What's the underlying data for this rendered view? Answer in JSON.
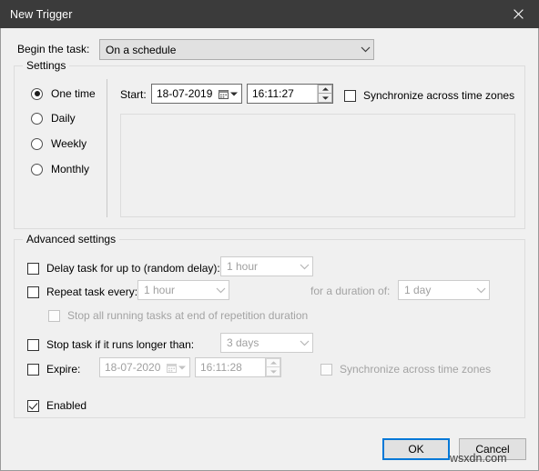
{
  "window": {
    "title": "New Trigger",
    "close_icon": "close-icon"
  },
  "begin": {
    "label": "Begin the task:",
    "value": "On a schedule",
    "arrow_icon": "chevron-down-icon"
  },
  "settings": {
    "group_title": "Settings",
    "schedule_options": [
      {
        "label": "One time",
        "checked": true
      },
      {
        "label": "Daily",
        "checked": false
      },
      {
        "label": "Weekly",
        "checked": false
      },
      {
        "label": "Monthly",
        "checked": false
      }
    ],
    "start": {
      "label": "Start:",
      "date": "18-07-2019",
      "time": "16:11:27",
      "calendar_icon": "calendar-icon",
      "date_arrow_icon": "chevron-down-icon",
      "spinner_up_icon": "spinner-up-icon",
      "spinner_down_icon": "spinner-down-icon"
    },
    "sync_timezones": {
      "label": "Synchronize across time zones",
      "checked": false
    }
  },
  "advanced": {
    "group_title": "Advanced settings",
    "delay_task": {
      "label": "Delay task for up to (random delay):",
      "checked": false,
      "value": "1 hour",
      "enabled": false
    },
    "repeat_task": {
      "label": "Repeat task every:",
      "checked": false,
      "value": "1 hour",
      "enabled": false
    },
    "duration": {
      "label": "for a duration of:",
      "value": "1 day",
      "enabled": false
    },
    "stop_all_running": {
      "label": "Stop all running tasks at end of repetition duration",
      "checked": false,
      "enabled": false
    },
    "stop_task_longer": {
      "label": "Stop task if it runs longer than:",
      "checked": false,
      "value": "3 days",
      "enabled": false
    },
    "expire": {
      "label": "Expire:",
      "checked": false,
      "date": "18-07-2020",
      "time": "16:11:28",
      "enabled": false
    },
    "expire_sync_timezones": {
      "label": "Synchronize across time zones",
      "checked": false,
      "enabled": false
    },
    "enabled_checkbox": {
      "label": "Enabled",
      "checked": true
    }
  },
  "footer": {
    "ok_label": "OK",
    "cancel_label": "Cancel",
    "watermark": "wsxdn.com"
  },
  "colors": {
    "titlebar": "#3b3b3b",
    "dialog_bg": "#f0f0f0",
    "focus_border": "#0078d7",
    "disabled_text": "#a0a0a0"
  }
}
